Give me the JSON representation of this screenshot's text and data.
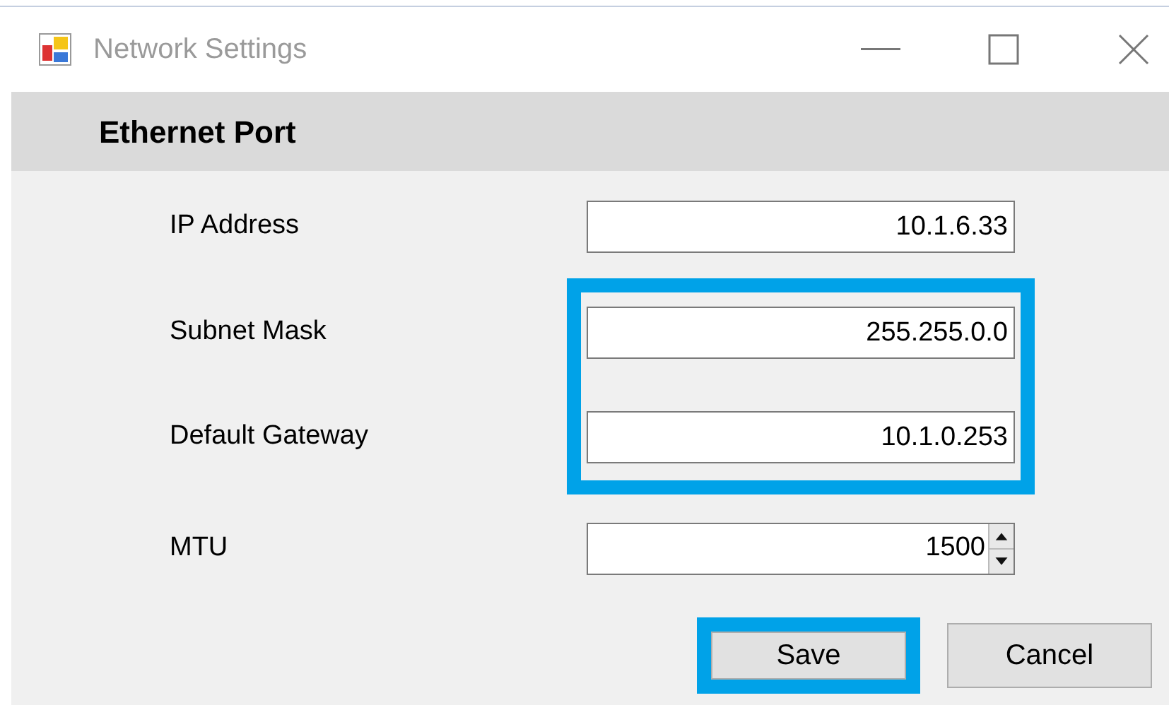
{
  "window": {
    "title": "Network Settings",
    "active": false
  },
  "section": {
    "title": "Ethernet Port"
  },
  "field_groups": [
    {
      "highlighted": false,
      "fields": [
        {
          "kind": "text",
          "label": "IP Address",
          "value": "10.1.6.33"
        }
      ]
    },
    {
      "highlighted": true,
      "fields": [
        {
          "kind": "text",
          "label": "Subnet Mask",
          "value": "255.255.0.0"
        },
        {
          "kind": "text",
          "label": "Default Gateway",
          "value": "10.1.0.253"
        }
      ]
    },
    {
      "highlighted": false,
      "fields": [
        {
          "kind": "spinner",
          "label": "MTU",
          "value": "1500"
        }
      ]
    }
  ],
  "buttons": [
    {
      "label": "Save",
      "highlighted": true
    },
    {
      "label": "Cancel",
      "highlighted": false
    }
  ]
}
